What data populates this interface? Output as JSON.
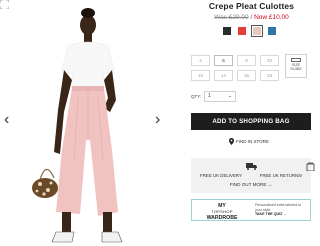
{
  "product": {
    "title": "Crepe Pleat Culottes",
    "was_price": "Was £29.00",
    "separator": "/",
    "now_price": "Now £10.00"
  },
  "swatches": [
    {
      "name": "black",
      "color": "#2b2b2b"
    },
    {
      "name": "red",
      "color": "#e23b3b"
    },
    {
      "name": "pink",
      "color": "#e8c7c0"
    },
    {
      "name": "blue",
      "color": "#2c77a5"
    }
  ],
  "sizes": [
    "4",
    "6",
    "8",
    "10",
    "12",
    "14",
    "16",
    "18"
  ],
  "size_guide": {
    "line1": "SIZE",
    "line2": "GUIDE"
  },
  "quantity": {
    "label": "QTY:",
    "value": "1",
    "chevron": "⌄"
  },
  "add_to_bag": "ADD TO SHOPPING BAG",
  "find_in_store": "FIND IN STORE",
  "delivery": {
    "uk": "FREE UK DELIVERY",
    "returns": "FREE UK RETURNS!",
    "find_out_more": "FIND OUT MORE →"
  },
  "wardrobe": {
    "my": "MY",
    "topshop": "TOPSHOP",
    "wardrobe": "WARDROBE",
    "desc": "Personalised edits tailored to your style",
    "quiz": "TAKE THE QUIZ →"
  },
  "gallery": {
    "prev": "‹",
    "next": "›"
  }
}
